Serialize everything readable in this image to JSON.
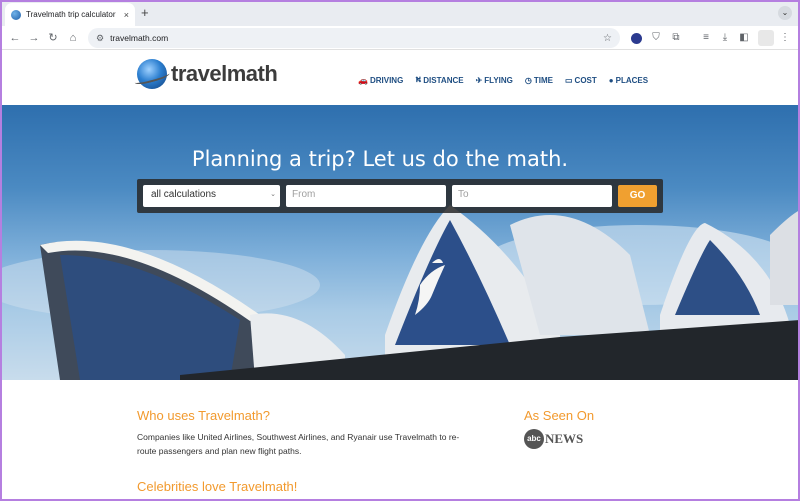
{
  "browser": {
    "tab_title": "Travelmath trip calculator",
    "tab_close": "×",
    "new_tab": "+",
    "url": "travelmath.com"
  },
  "site": {
    "logo_text": "travelmath",
    "nav": [
      {
        "label": "DRIVING",
        "icon": "car-icon",
        "glyph": "🚗"
      },
      {
        "label": "DISTANCE",
        "icon": "road-icon",
        "glyph": "⛕"
      },
      {
        "label": "FLYING",
        "icon": "plane-icon",
        "glyph": "✈"
      },
      {
        "label": "TIME",
        "icon": "clock-icon",
        "glyph": "◷"
      },
      {
        "label": "COST",
        "icon": "card-icon",
        "glyph": "▭"
      },
      {
        "label": "PLACES",
        "icon": "globe-icon",
        "glyph": "●"
      }
    ]
  },
  "hero": {
    "title": "Planning a trip? Let us do the math.",
    "select_value": "all calculations",
    "from_placeholder": "From",
    "to_placeholder": "To",
    "go_label": "GO"
  },
  "content": {
    "who_heading": "Who uses Travelmath?",
    "who_text": "Companies like United Airlines, Southwest Airlines, and Ryanair use Travelmath to re-route passengers and plan new flight paths.",
    "celeb_heading": "Celebrities love Travelmath!",
    "seen_heading": "As Seen On",
    "abc_disc": "abc",
    "abc_news": "NEWS"
  },
  "colors": {
    "accent_orange": "#f29a2e",
    "go_button": "#f0a030",
    "nav_blue": "#1f4e82"
  }
}
